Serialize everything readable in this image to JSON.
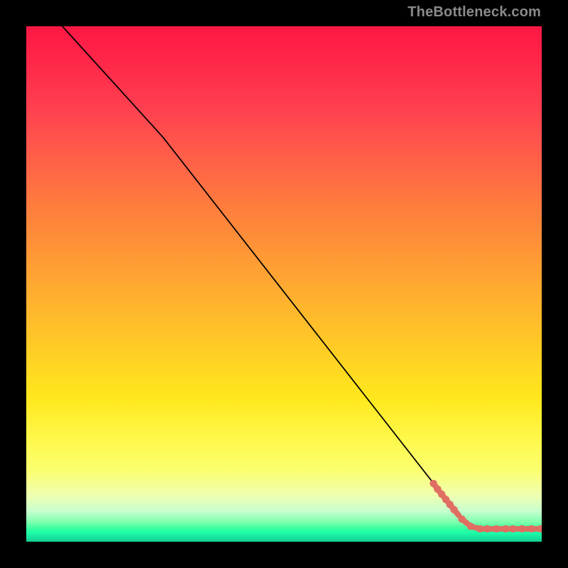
{
  "watermark": "TheBottleneck.com",
  "chart_data": {
    "type": "line",
    "title": "",
    "xlabel": "",
    "ylabel": "",
    "xlim": [
      0,
      1000
    ],
    "ylim": [
      0,
      1000
    ],
    "grid": false,
    "legend": false,
    "background": "vertical-gradient red→yellow→green",
    "series": [
      {
        "name": "curve",
        "style": "solid-black",
        "x": [
          70,
          265,
          820,
          860,
          1000
        ],
        "y": [
          1000,
          785,
          75,
          28,
          25
        ]
      },
      {
        "name": "dotted-segment",
        "style": "dotted-salmon-thick",
        "x": [
          790,
          798,
          806,
          814,
          822,
          830,
          845,
          862,
          880,
          894,
          912,
          930,
          944,
          962,
          980,
          998
        ],
        "y": [
          113,
          102,
          92,
          82,
          72,
          62,
          44,
          30,
          25,
          25,
          25,
          25,
          25,
          25,
          25,
          25
        ]
      }
    ]
  }
}
